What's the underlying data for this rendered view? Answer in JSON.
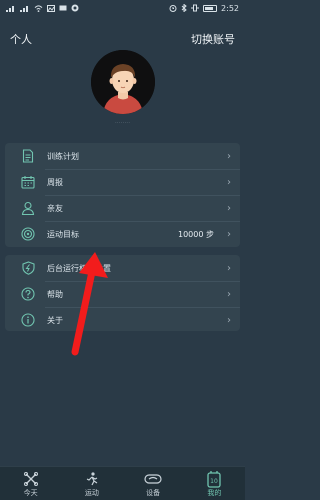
{
  "status_bar": {
    "time": "2:52",
    "left_icons": [
      "signal-icon",
      "signal-icon",
      "wifi-icon",
      "image-icon",
      "message-icon",
      "circle-icon"
    ],
    "right_icons": [
      "alarm-icon",
      "bluetooth-icon",
      "vibrate-icon",
      "battery-icon"
    ]
  },
  "header": {
    "title": "个人",
    "switch_account": "切换账号"
  },
  "profile": {
    "name": "........"
  },
  "menu_group_1": [
    {
      "icon": "document-icon",
      "label": "训练计划",
      "value": ""
    },
    {
      "icon": "calendar-icon",
      "label": "周报",
      "value": ""
    },
    {
      "icon": "person-icon",
      "label": "亲友",
      "value": ""
    },
    {
      "icon": "target-icon",
      "label": "运动目标",
      "value": "10000 步"
    }
  ],
  "menu_group_2": [
    {
      "icon": "shield-icon",
      "label": "后台运行权限设置"
    },
    {
      "icon": "help-icon",
      "label": "帮助"
    },
    {
      "icon": "info-icon",
      "label": "关于"
    }
  ],
  "tabs": [
    {
      "icon": "today-icon",
      "label": "今天",
      "active": false
    },
    {
      "icon": "exercise-icon",
      "label": "运动",
      "active": false
    },
    {
      "icon": "device-icon",
      "label": "设备",
      "active": false
    },
    {
      "icon": "mine-icon",
      "label": "我的",
      "active": true,
      "badge": "10"
    }
  ],
  "colors": {
    "background": "#2a3a47",
    "card": "#33444f",
    "accent": "#71c5b0",
    "arrow": "#f21c1c"
  }
}
